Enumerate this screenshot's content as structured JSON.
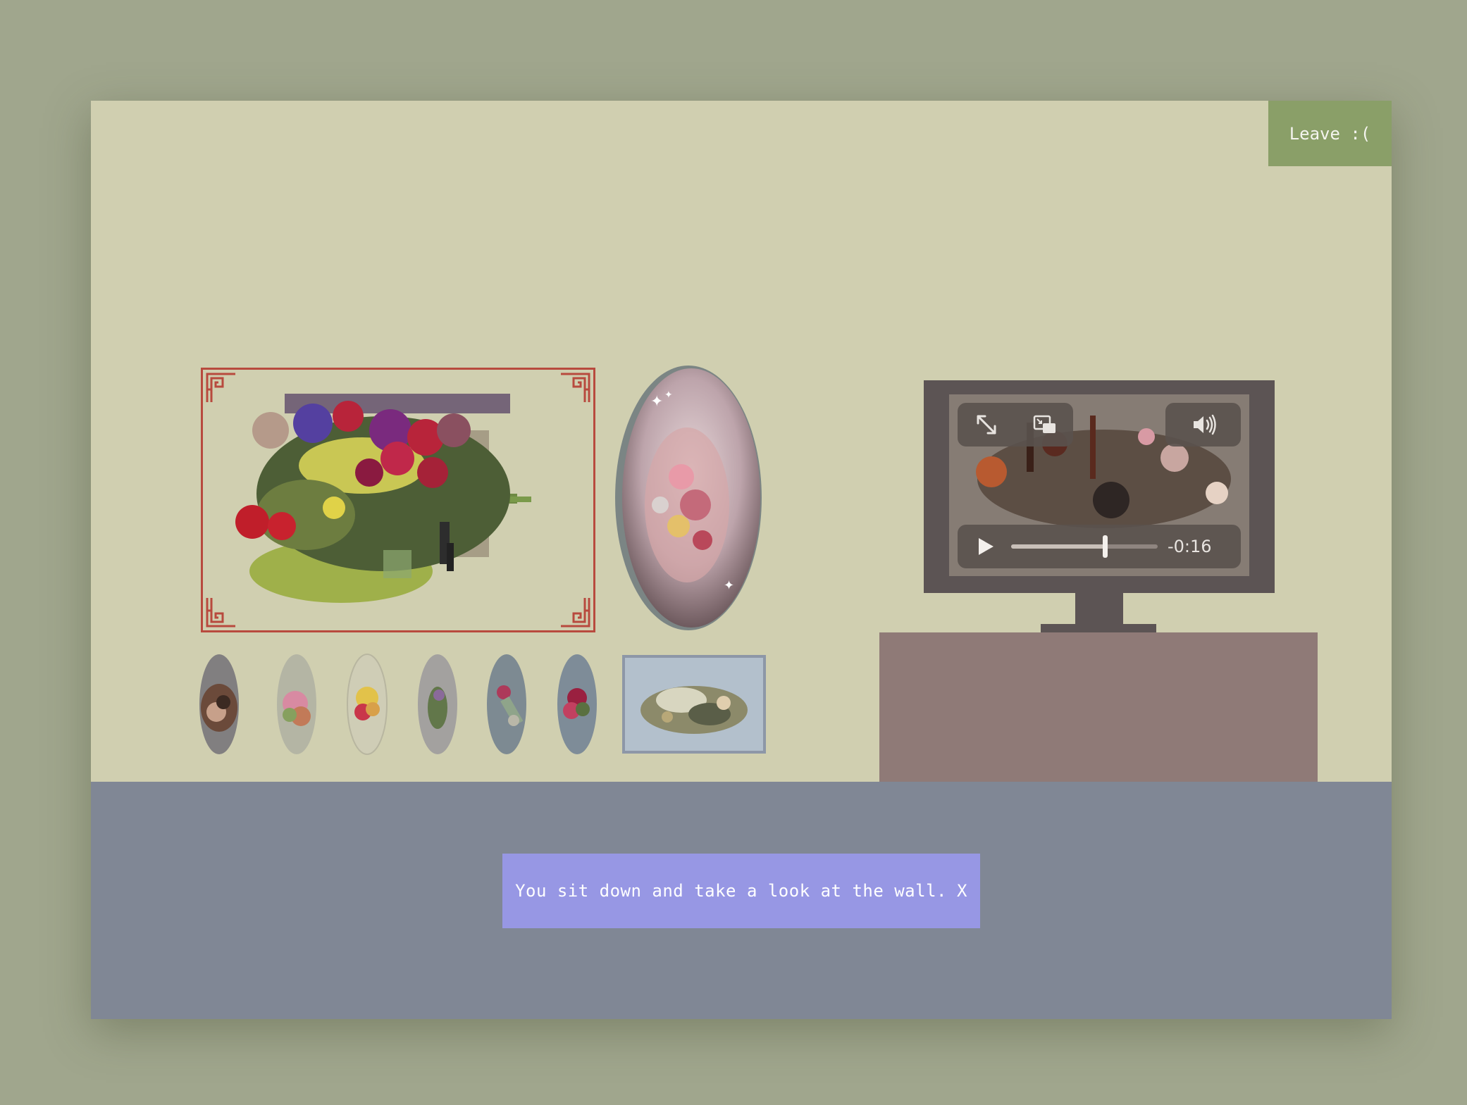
{
  "header": {
    "leave_label": "Leave :("
  },
  "dialog": {
    "text": "You sit down and take a look at the wall.",
    "close_label": "X"
  },
  "video": {
    "time_remaining": "-0:16",
    "progress": 0.64,
    "controls": [
      "expand-icon",
      "picture-in-picture-icon",
      "volume-icon",
      "play-icon"
    ]
  },
  "colors": {
    "wall": "#d0cfb0",
    "floor": "#808795",
    "leave_button": "#8a9f68",
    "dialog": "#9797e4",
    "frame": "#b84a3e",
    "tv": "#5c5454",
    "cabinet": "#8f7a77"
  }
}
